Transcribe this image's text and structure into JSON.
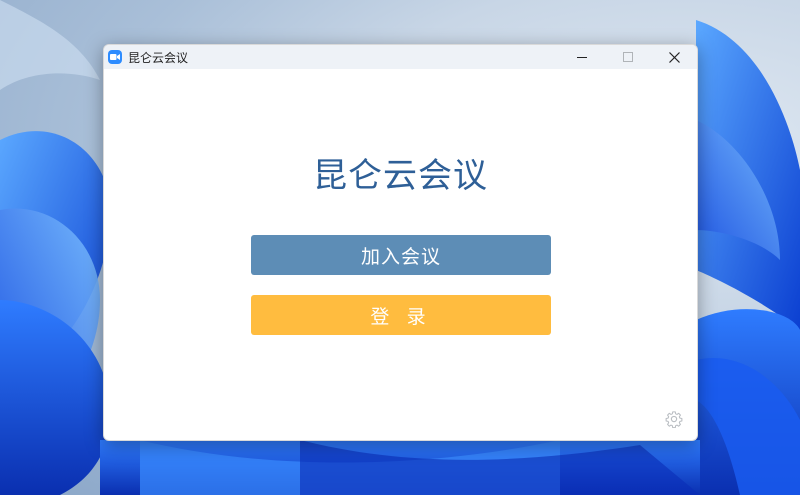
{
  "window": {
    "title": "昆仑云会议"
  },
  "main": {
    "title": "昆仑云会议",
    "join_label": "加入会议",
    "login_label": "登 录"
  },
  "icons": {
    "app": "video-camera-icon",
    "settings": "gear-icon",
    "minimize": "minimize-icon",
    "maximize": "maximize-icon",
    "close": "close-icon"
  },
  "colors": {
    "join": "#5d8db6",
    "login": "#ffbc3f",
    "title": "#2e5f97",
    "app_icon": "#2d8cff"
  }
}
